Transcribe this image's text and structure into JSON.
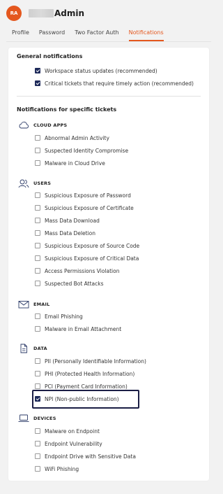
{
  "header": {
    "avatar_initials": "RA",
    "title": "Admin"
  },
  "tabs": [
    "Profile",
    "Password",
    "Two Factor Auth",
    "Notifications"
  ],
  "general": {
    "title": "General notifications",
    "items": [
      {
        "label": "Workspace status updates (recommended)",
        "checked": true
      },
      {
        "label": "Critical tickets that require timely action (recommended)",
        "checked": true
      }
    ]
  },
  "specific": {
    "title": "Notifications for specific tickets",
    "groups": [
      {
        "name": "CLOUD APPS",
        "icon": "cloud-icon",
        "items": [
          "Abnormal Admin Activity",
          "Suspected Identity Compromise",
          "Malware in Cloud Drive"
        ]
      },
      {
        "name": "USERS",
        "icon": "users-icon",
        "items": [
          "Suspicious Exposure of Password",
          "Suspicious Exposure of Certificate",
          "Mass Data Download",
          "Mass Data Deletion",
          "Suspicious Exposure of Source Code",
          "Suspicious Exposure of Critical Data",
          "Access Permissions Violation",
          "Suspected Bot Attacks"
        ]
      },
      {
        "name": "EMAIL",
        "icon": "envelope-icon",
        "items": [
          "Email Phishing",
          "Malware in Email Attachment"
        ]
      },
      {
        "name": "DATA",
        "icon": "document-icon",
        "items": [
          "PII (Personally Identifiable Information)",
          "PHI (Protected Health Information)",
          "PCI (Payment Card Information)",
          "NPI (Non-public Information)"
        ]
      },
      {
        "name": "DEVICES",
        "icon": "laptop-icon",
        "items": [
          "Malware on Endpoint",
          "Endpoint Vulnerability",
          "Endpoint Drive with Sensitive Data",
          "WiFi Phishing"
        ]
      }
    ]
  },
  "colors": {
    "accent": "#e4571e",
    "checkbox_checked": "#1e2a5a",
    "highlight_border": "#1b1e45"
  }
}
